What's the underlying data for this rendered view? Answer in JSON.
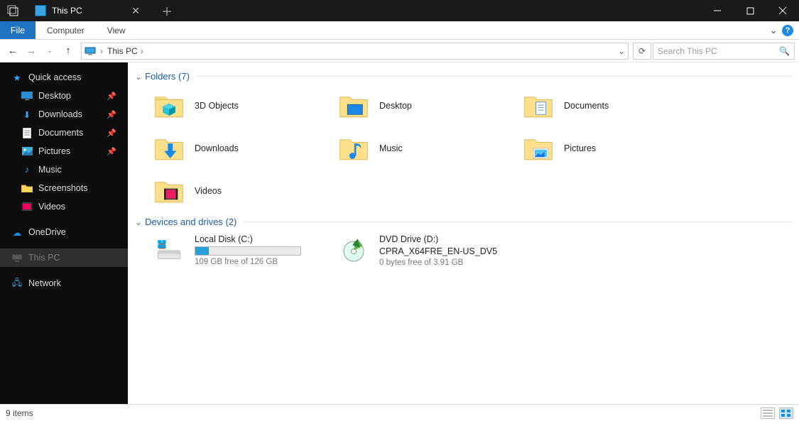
{
  "title": "This PC",
  "ribbon": {
    "file": "File",
    "tabs": [
      "Computer",
      "View"
    ]
  },
  "breadcrumb": {
    "location": "This PC"
  },
  "search": {
    "placeholder": "Search This PC"
  },
  "sidebar": {
    "quickaccess": "Quick access",
    "items": [
      {
        "label": "Desktop",
        "pinned": true
      },
      {
        "label": "Downloads",
        "pinned": true
      },
      {
        "label": "Documents",
        "pinned": true
      },
      {
        "label": "Pictures",
        "pinned": true
      },
      {
        "label": "Music",
        "pinned": false
      },
      {
        "label": "Screenshots",
        "pinned": false
      },
      {
        "label": "Videos",
        "pinned": false
      }
    ],
    "onedrive": "OneDrive",
    "thispc": "This PC",
    "network": "Network"
  },
  "groups": {
    "folders": {
      "header": "Folders (7)",
      "items": [
        "3D Objects",
        "Desktop",
        "Documents",
        "Downloads",
        "Music",
        "Pictures",
        "Videos"
      ]
    },
    "drives": {
      "header": "Devices and drives (2)",
      "items": [
        {
          "name": "Local Disk (C:)",
          "free_text": "109 GB free of 126 GB",
          "used_pct": 13
        },
        {
          "name": "DVD Drive (D:)",
          "sub": "CPRA_X64FRE_EN-US_DV5",
          "free_text": "0 bytes free of 3.91 GB"
        }
      ]
    }
  },
  "status": {
    "text": "9 items"
  }
}
